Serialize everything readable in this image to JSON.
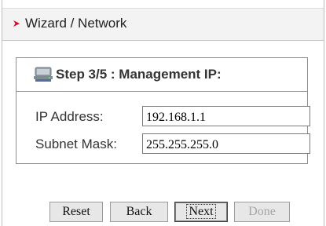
{
  "header": {
    "title": "Wizard / Network",
    "bullet_color": "#e8002a"
  },
  "step": {
    "icon": "network-computer-icon",
    "title": "Step 3/5 : Management IP:"
  },
  "form": {
    "ip_address": {
      "label": "IP Address:",
      "value": "192.168.1.1"
    },
    "subnet_mask": {
      "label": "Subnet Mask:",
      "value": "255.255.255.0"
    }
  },
  "buttons": {
    "reset": "Reset",
    "back": "Back",
    "next": "Next",
    "done": "Done"
  }
}
